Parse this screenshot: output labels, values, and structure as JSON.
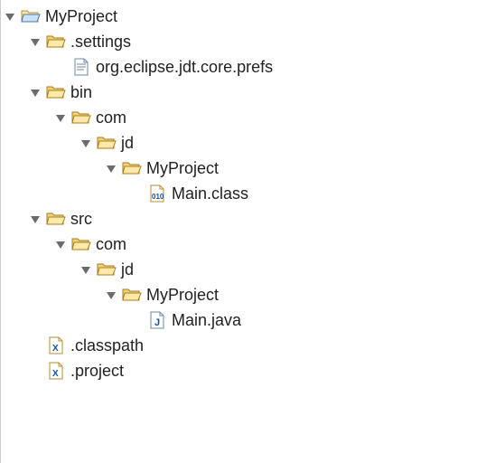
{
  "tree": {
    "root": {
      "label": "MyProject",
      "settings": {
        "label": ".settings",
        "prefs": {
          "label": "org.eclipse.jdt.core.prefs"
        }
      },
      "bin": {
        "label": "bin",
        "com": {
          "label": "com",
          "jd": {
            "label": "jd",
            "myproject": {
              "label": "MyProject",
              "main_class": {
                "label": "Main.class"
              }
            }
          }
        }
      },
      "src": {
        "label": "src",
        "com": {
          "label": "com",
          "jd": {
            "label": "jd",
            "myproject": {
              "label": "MyProject",
              "main_java": {
                "label": "Main.java"
              }
            }
          }
        }
      },
      "classpath": {
        "label": ".classpath"
      },
      "project": {
        "label": ".project"
      }
    }
  }
}
